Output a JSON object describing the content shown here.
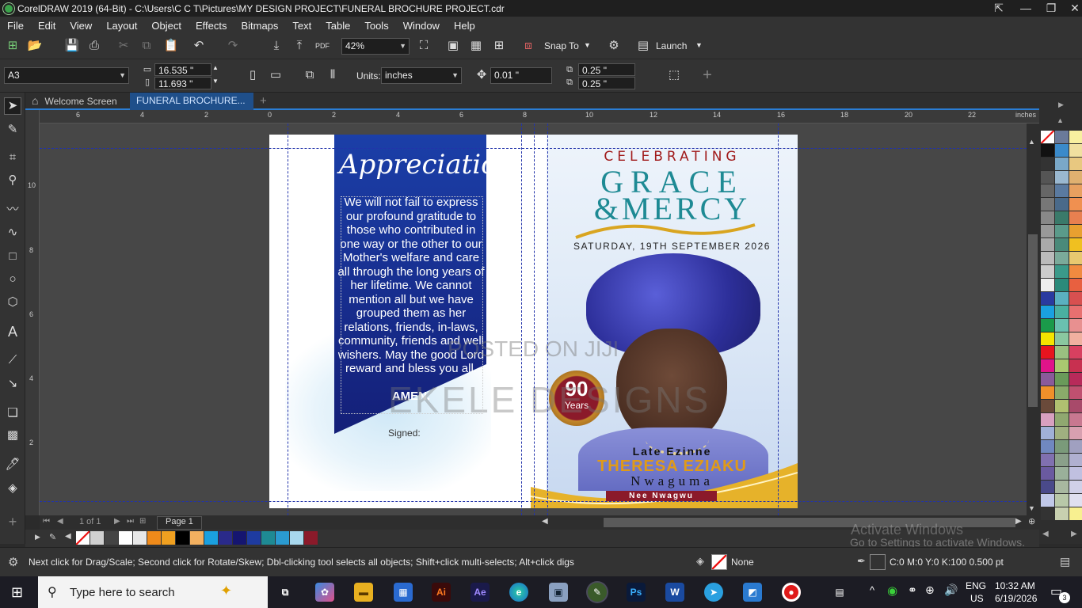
{
  "window": {
    "title": "CorelDRAW 2019 (64-Bit) - C:\\Users\\C C T\\Pictures\\MY DESIGN PROJECT\\FUNERAL BROCHURE PROJECT.cdr"
  },
  "menu": [
    "File",
    "Edit",
    "View",
    "Layout",
    "Object",
    "Effects",
    "Bitmaps",
    "Text",
    "Table",
    "Tools",
    "Window",
    "Help"
  ],
  "toolbar": {
    "zoom": "42%",
    "snap_label": "Snap To",
    "launch_label": "Launch"
  },
  "props": {
    "page_size": "A3",
    "width": "16.535 \"",
    "height": "11.693 \"",
    "units_label": "Units:",
    "units": "inches",
    "nudge": "0.01 \"",
    "dup_x": "0.25 \"",
    "dup_y": "0.25 \""
  },
  "tabs": [
    {
      "label": "Welcome Screen"
    },
    {
      "label": "FUNERAL BROCHURE..."
    }
  ],
  "ruler": {
    "h_labels": [
      "6",
      "4",
      "2",
      "0",
      "2",
      "4",
      "6",
      "8",
      "10",
      "12",
      "14",
      "16",
      "18",
      "20",
      "22"
    ],
    "h_unit": "inches",
    "v_labels": [
      "10",
      "8",
      "6",
      "4",
      "2"
    ]
  },
  "page": {
    "appreciation_title": "Appreciation",
    "appreciation_body": "We will not fail to express our profound gratitude to those who contributed in one way or the other to our Mother's welfare and care all through the long years of her lifetime. We cannot mention all but we have grouped them as her relations, friends, in-laws, community, friends and well wishers. May the good Lord reward and bless you all.",
    "amen": "AMEN.",
    "signed": "Signed:",
    "celebrating": "CELEBRATING",
    "grace": "GRACE",
    "mercy": "&MERCY",
    "date": "SATURDAY, 19TH SEPTEMBER 2026",
    "badge_number": "90",
    "badge_label": "Years",
    "late": "Late Ezinne",
    "name": "THERESA EZIAKU",
    "surname": "Nwaguma",
    "nee": "Nee Nwagwu",
    "watermark_posted": "POSTED ON JIJI",
    "watermark_brand": "EKELE DESIGNS"
  },
  "pager": {
    "info": "1 of 1",
    "page_tab": "Page 1"
  },
  "status": {
    "hint": "Next click for Drag/Scale; Second click for Rotate/Skew; Dbl-clicking tool selects all objects; Shift+click multi-selects; Alt+click digs",
    "fill": "None",
    "outline": "C:0 M:0 Y:0 K:100  0.500 pt"
  },
  "activate": {
    "line1": "Activate Windows",
    "line2": "Go to Settings to activate Windows."
  },
  "taskbar": {
    "search_placeholder": "Type here to search",
    "lang1": "ENG",
    "lang2": "US",
    "time": "10:32 AM",
    "date": "6/19/2026",
    "notif_count": "3"
  },
  "colors": {
    "accent": "#2a7dd4",
    "panel_bg": "#333333",
    "canvas_bg": "#474747",
    "banner_blue": "#1a2a8c",
    "teal": "#1e8a94",
    "gold": "#e0a81e",
    "maroon": "#8b1a2a"
  }
}
